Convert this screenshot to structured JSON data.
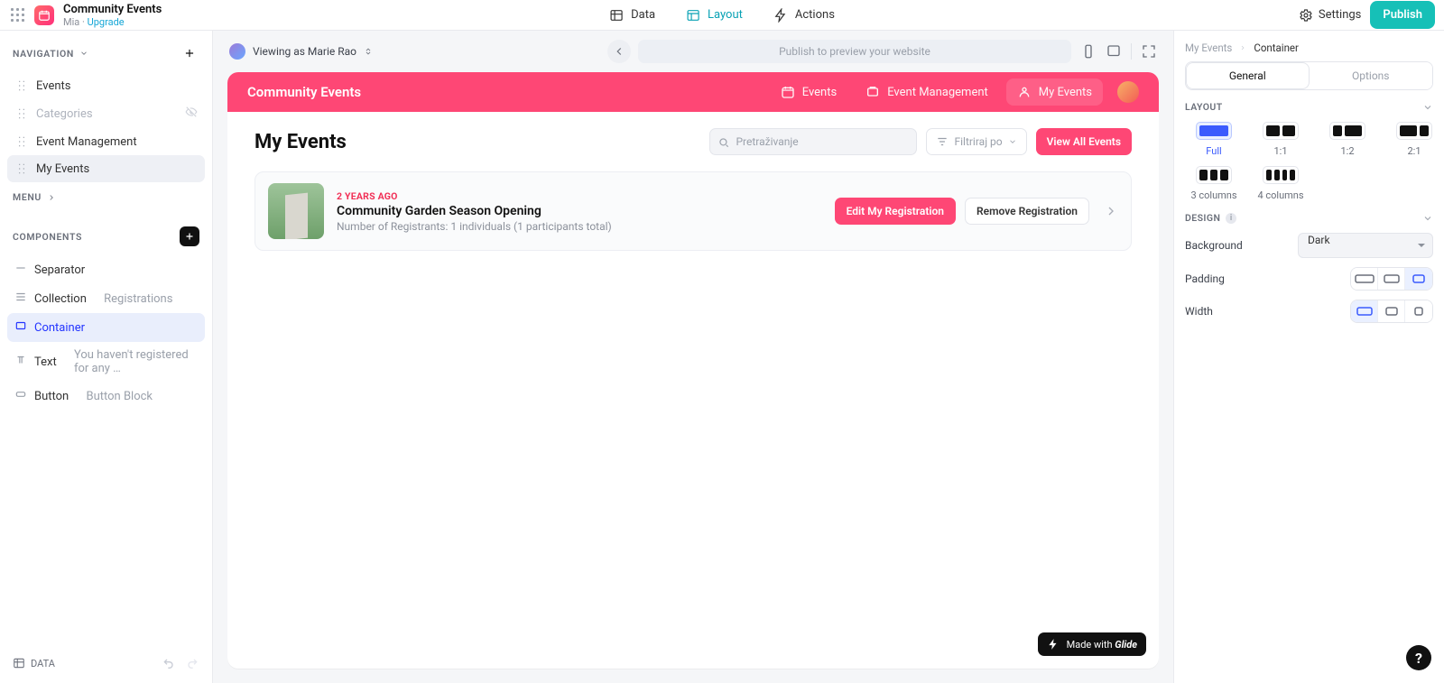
{
  "app": {
    "name": "Community Events",
    "owner": "Mia",
    "upgrade": "Upgrade",
    "dot": " · "
  },
  "top_tabs": [
    "Data",
    "Layout",
    "Actions"
  ],
  "top_tabs_active": 1,
  "top_right": {
    "settings": "Settings",
    "publish": "Publish"
  },
  "left": {
    "nav_header": "NAVIGATION",
    "menu_header": "MENU",
    "comps_header": "COMPONENTS",
    "nav": [
      {
        "label": "Events",
        "muted": false
      },
      {
        "label": "Categories",
        "muted": true,
        "hidden": true
      },
      {
        "label": "Event Management",
        "muted": false
      },
      {
        "label": "My Events",
        "muted": false,
        "selected": true
      }
    ],
    "components": [
      {
        "kind": "separator",
        "label": "Separator"
      },
      {
        "kind": "collection",
        "label": "Collection",
        "sub": "Registrations"
      },
      {
        "kind": "container",
        "label": "Container",
        "active": true
      },
      {
        "kind": "text",
        "label": "Text",
        "sub": "You haven't registered for any …"
      },
      {
        "kind": "button",
        "label": "Button",
        "sub": "Button Block"
      }
    ],
    "footer_data": "DATA"
  },
  "stage": {
    "viewing_as_prefix": "Viewing as ",
    "viewing_as": "Marie Rao",
    "publish_hint": "Publish to preview your website"
  },
  "preview": {
    "brand": "Community Events",
    "tabs": [
      "Events",
      "Event Management",
      "My Events"
    ],
    "tabs_active": 2,
    "page_title": "My Events",
    "search_placeholder": "Pretraživanje",
    "filter_label": "Filtriraj po",
    "view_all": "View All Events",
    "row": {
      "ago": "2 YEARS AGO",
      "title": "Community Garden Season Opening",
      "sub": "Number of Registrants: 1 individuals (1 participants total)",
      "edit": "Edit My Registration",
      "remove": "Remove Registration"
    },
    "made": {
      "prefix": "Made with ",
      "brand": "Glide"
    }
  },
  "right": {
    "crumbs": [
      "My Events",
      "Container"
    ],
    "seg": [
      "General",
      "Options"
    ],
    "seg_active": 0,
    "layout_header": "LAYOUT",
    "layout_options": [
      {
        "label": "Full",
        "cols": [
          1
        ],
        "selected": true
      },
      {
        "label": "1:1",
        "cols": [
          1,
          1
        ]
      },
      {
        "label": "1:2",
        "cols": [
          1,
          2
        ]
      },
      {
        "label": "2:1",
        "cols": [
          2,
          1
        ]
      },
      {
        "label": "3 columns",
        "cols": [
          1,
          1,
          1
        ]
      },
      {
        "label": "4 columns",
        "cols": [
          1,
          1,
          1,
          1
        ]
      }
    ],
    "design_header": "DESIGN",
    "background_label": "Background",
    "background_value": "Dark",
    "padding_label": "Padding",
    "padding_selected": 2,
    "width_label": "Width",
    "width_selected": 0
  },
  "icons": {
    "search": "search-icon",
    "chev_down": "chevron-down-icon",
    "plus": "plus-icon",
    "back": "back-icon"
  }
}
